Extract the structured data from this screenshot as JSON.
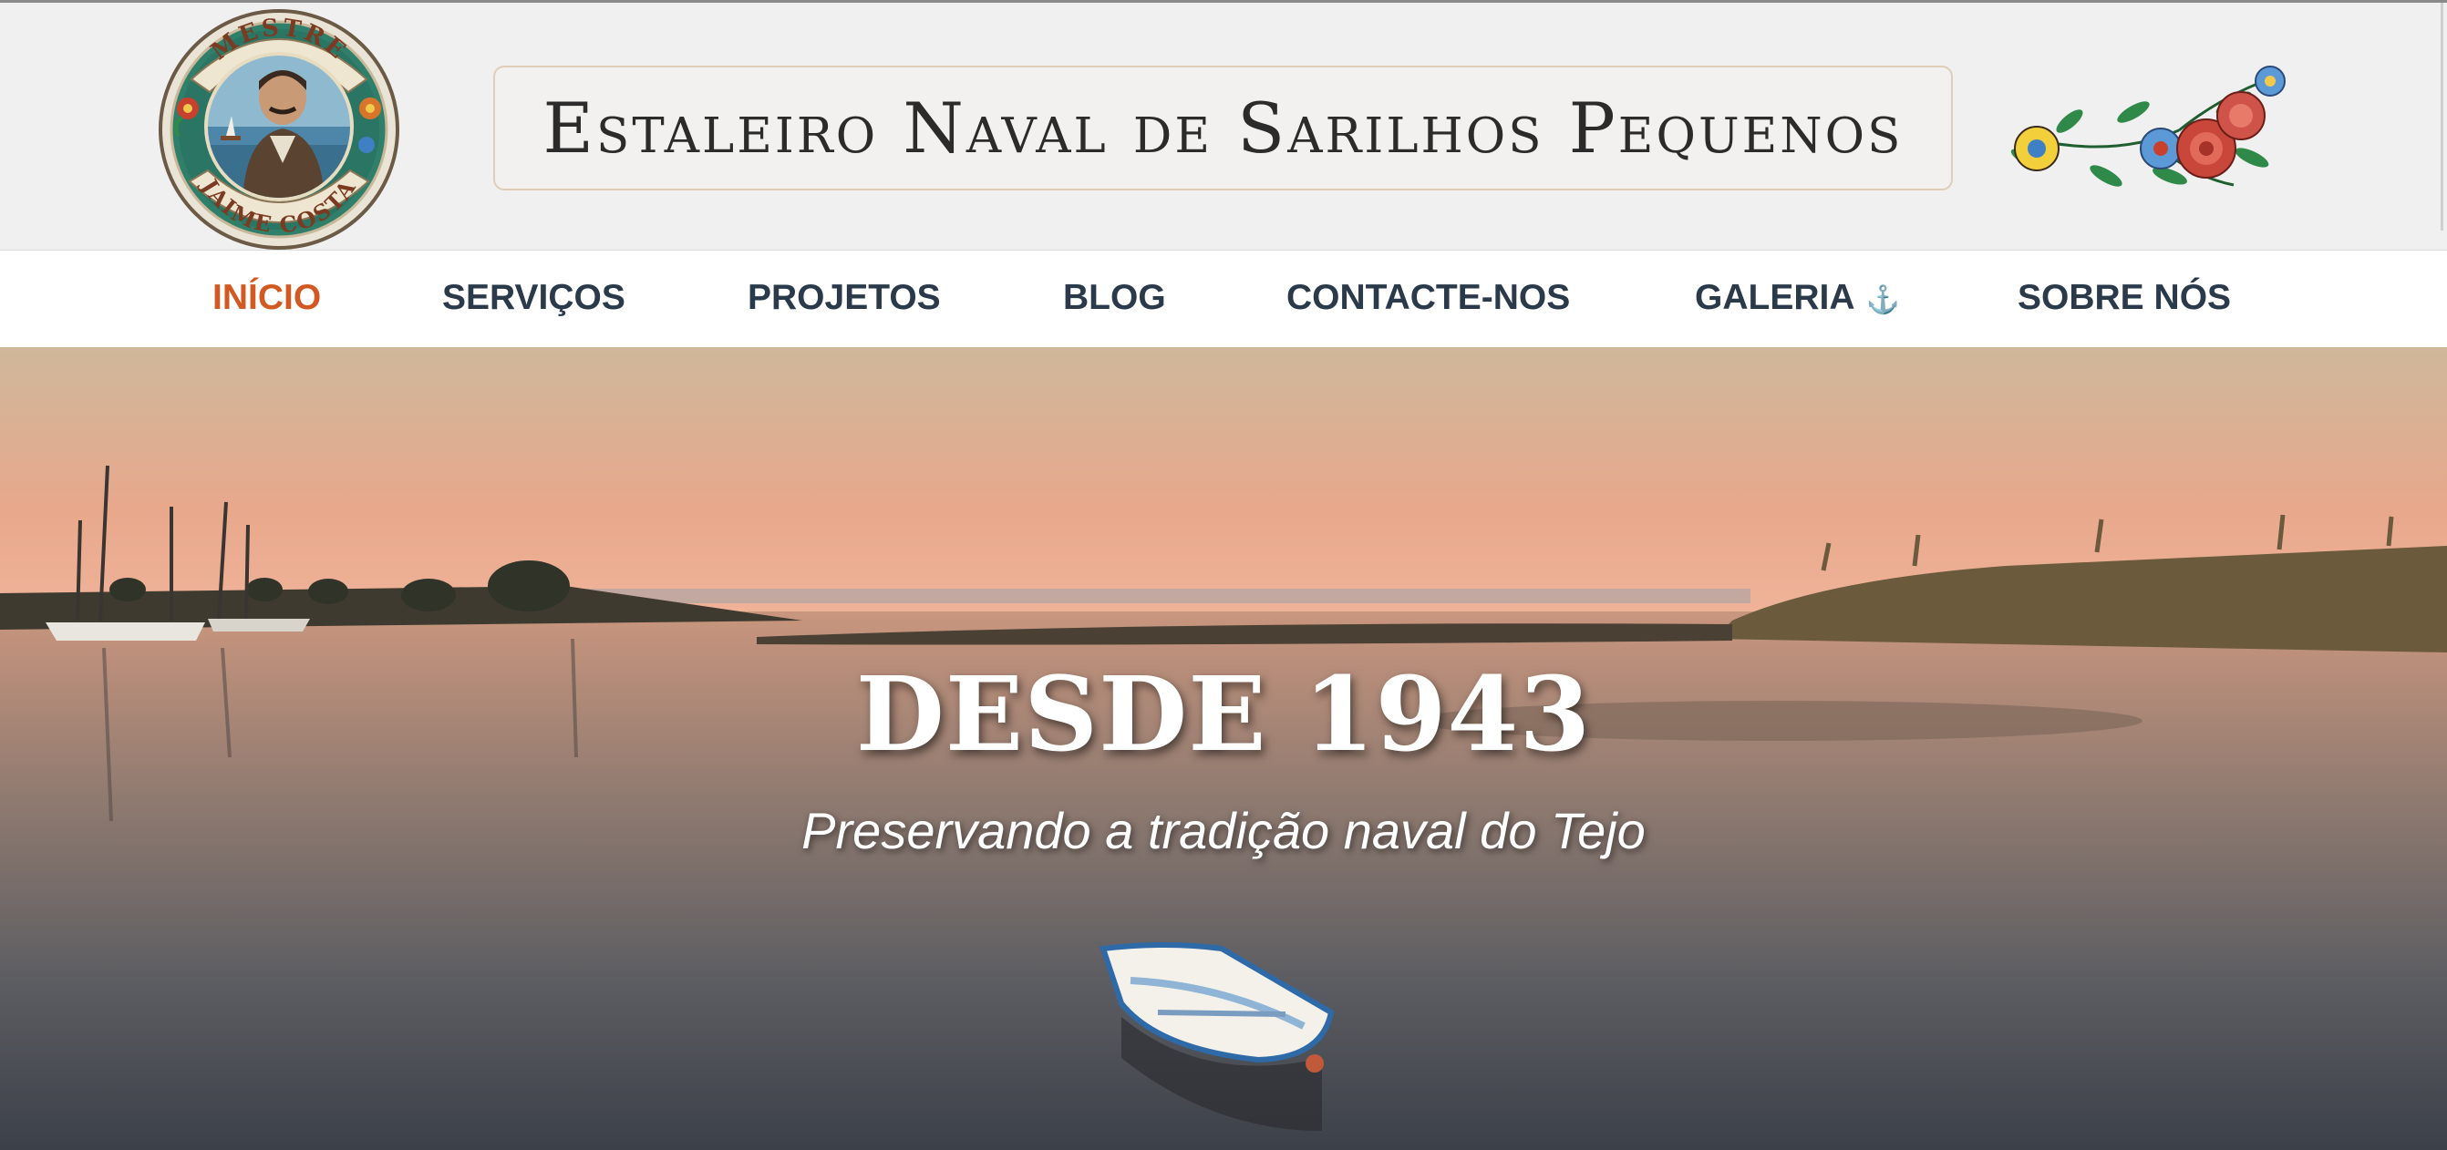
{
  "header": {
    "logo": {
      "top_text": "MESTRE",
      "bottom_text": "JAIME COSTA"
    },
    "site_title": "Estaleiro Naval de Sarilhos Pequenos"
  },
  "nav": {
    "items": [
      {
        "label": "INÍCIO",
        "active": true
      },
      {
        "label": "SERVIÇOS"
      },
      {
        "label": "PROJETOS"
      },
      {
        "label": "BLOG"
      },
      {
        "label": "CONTACTE-NOS"
      },
      {
        "label": "GALERIA",
        "icon": "anchor-icon"
      },
      {
        "label": "SOBRE NÓS"
      }
    ]
  },
  "hero": {
    "heading": "DESDE 1943",
    "subheading": "Preservando a tradição naval do Tejo"
  },
  "colors": {
    "nav_text": "#2b3a4a",
    "nav_active": "#d25a22",
    "anchor_icon": "#4aa3df",
    "header_bg": "#f0f0f0"
  }
}
